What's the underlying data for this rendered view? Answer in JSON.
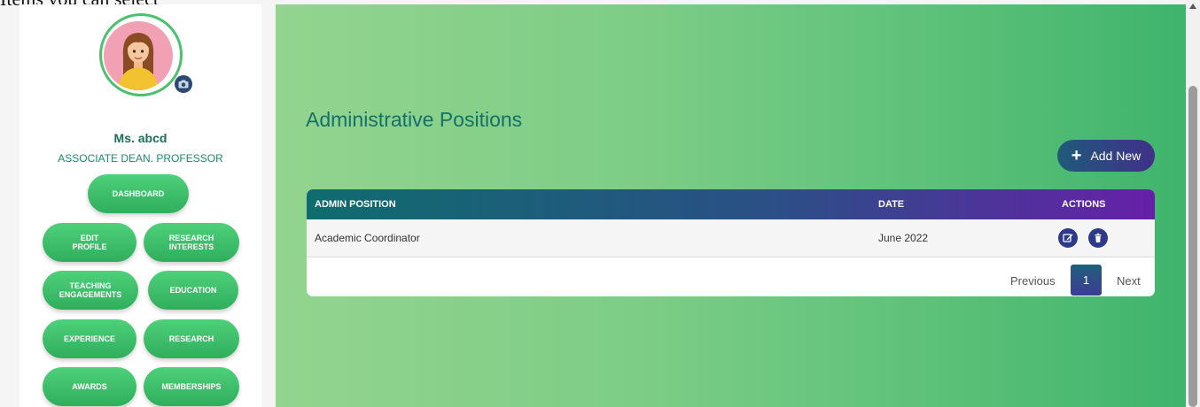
{
  "top_clipped_text": "Items you can select",
  "sidebar": {
    "user_name": "Ms. abcd",
    "user_role": "ASSOCIATE DEAN. PROFESSOR",
    "nav": {
      "dashboard": "DASHBOARD",
      "edit_profile": "EDIT\nPROFILE",
      "research_interests": "RESEARCH\nINTERESTS",
      "teaching_engagements": "TEACHING\nENGAGEMENTS",
      "education": "EDUCATION",
      "experience": "EXPERIENCE",
      "research": "RESEARCH",
      "awards": "AWARDS",
      "memberships": "MEMBERSHIPS"
    }
  },
  "main": {
    "title": "Administrative Positions",
    "add_button": "Add New",
    "table": {
      "headers": {
        "position": "ADMIN POSITION",
        "date": "DATE",
        "actions": "ACTIONS"
      },
      "rows": [
        {
          "position": "Academic Coordinator",
          "date": "June 2022"
        }
      ]
    },
    "pagination": {
      "previous": "Previous",
      "current": "1",
      "next": "Next"
    }
  },
  "colors": {
    "accent_green": "#3fb46c",
    "header_teal": "#0f6c6e",
    "header_purple": "#6620a8",
    "title_color": "#15706a"
  },
  "icons": [
    "camera-icon",
    "plus-icon",
    "edit-icon",
    "trash-icon",
    "scroll-up-arrow-icon"
  ]
}
